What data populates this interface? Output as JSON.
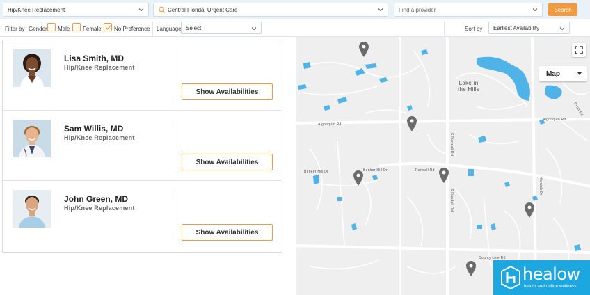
{
  "search": {
    "specialty_value": "Hip/Knee Replacement",
    "location_value": "Central Florida, Urgent Care",
    "provider_placeholder": "Find a provider",
    "search_label": "Search"
  },
  "filters": {
    "filter_by_label": "Filter by",
    "gender_label": "Gender",
    "options": [
      {
        "label": "Male",
        "checked": false
      },
      {
        "label": "Female",
        "checked": false
      },
      {
        "label": "No Preference",
        "checked": true
      }
    ],
    "language_label": "Language",
    "language_value": "Select",
    "sort_label": "Sort by",
    "sort_value": "Earliest Availability"
  },
  "providers": [
    {
      "name": "Lisa Smith, MD",
      "specialty": "Hip/Knee Replacement",
      "button": "Show Availabilities"
    },
    {
      "name": "Sam Willis, MD",
      "specialty": "Hip/Knee Replacement",
      "button": "Show Availabilities"
    },
    {
      "name": "John Green, MD",
      "specialty": "Hip/Knee Replacement",
      "button": "Show Availabilities"
    }
  ],
  "map": {
    "type_label": "Map",
    "place_label_line1": "Lake in",
    "place_label_line2": "the Hills",
    "road_labels": [
      "Algonquin Rd",
      "Algonquin Rd",
      "Bunker Hill Dr",
      "S Randall Rd",
      "S Randall Rd",
      "Harnish Dr",
      "Pyott Rd",
      "Bunker Hill Dr",
      "Randall Rd",
      "County Line Rd"
    ]
  },
  "brand": {
    "name": "healow",
    "tagline": "health and online wellness",
    "accent_color": "#f39a3e",
    "brand_color": "#1da7e0",
    "water_color": "#4fb3e8"
  },
  "icons": {
    "location": "map-pin-icon",
    "dropdown": "chevron-down-icon",
    "check": "check-icon",
    "fullscreen": "fullscreen-icon",
    "marker": "map-marker-icon"
  }
}
